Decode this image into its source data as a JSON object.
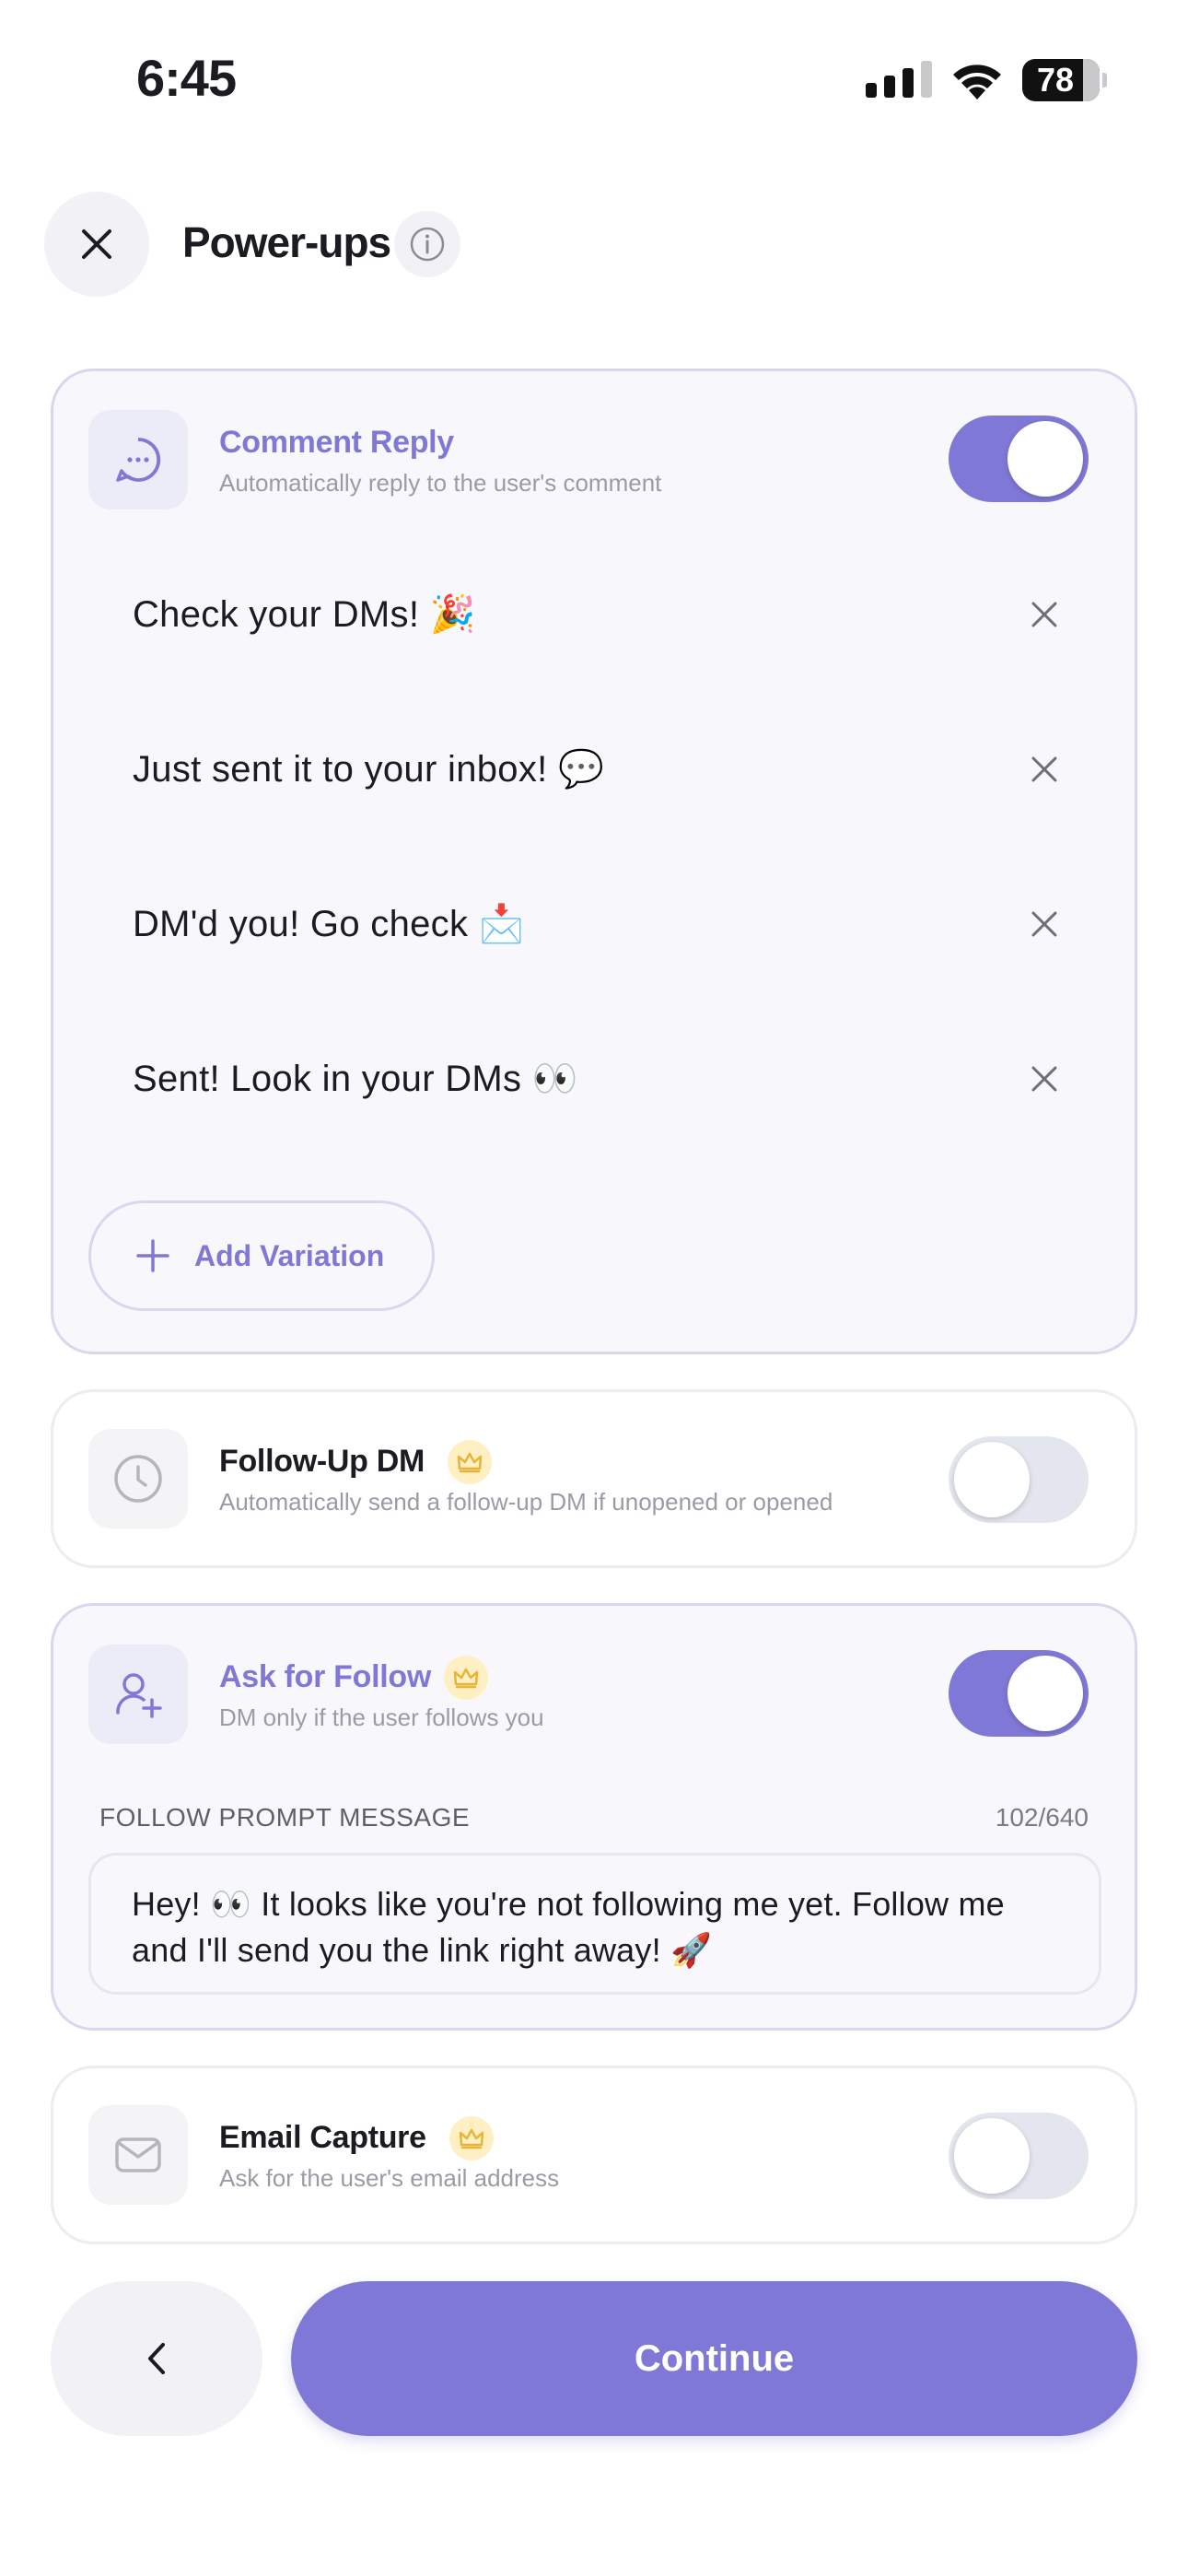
{
  "status_bar": {
    "time": "6:45",
    "battery": "78",
    "battery_level_percent": 78
  },
  "header": {
    "close_icon": "close-icon",
    "title": "Power-ups",
    "info_icon": "info-icon"
  },
  "comment_reply": {
    "title": "Comment Reply",
    "subtitle": "Automatically reply to the user's comment",
    "icon": "chat-bubble-icon",
    "enabled": true,
    "variations": [
      "Check your DMs! 🎉",
      "Just sent it to your inbox! 💬",
      "DM'd you! Go check 📩",
      "Sent! Look in your DMs 👀"
    ],
    "add_label": "Add Variation"
  },
  "follow_up_dm": {
    "title": "Follow-Up DM",
    "subtitle": "Automatically send a follow-up DM if unopened or opened",
    "icon": "clock-icon",
    "premium_icon": "crown-icon",
    "enabled": false
  },
  "ask_for_follow": {
    "title": "Ask for Follow",
    "subtitle": "DM only if the user follows you",
    "icon": "user-plus-icon",
    "premium_icon": "crown-icon",
    "enabled": true,
    "field_label": "FOLLOW PROMPT MESSAGE",
    "char_count": "102/640",
    "message": "Hey! 👀 It looks like you're not following me yet. Follow me and I'll send you the link right away! 🚀"
  },
  "email_capture": {
    "title": "Email Capture",
    "subtitle": "Ask for the user's email address",
    "icon": "envelope-icon",
    "premium_icon": "crown-icon",
    "enabled": false
  },
  "footer": {
    "back_icon": "chevron-left-icon",
    "continue_label": "Continue"
  },
  "colors": {
    "accent": "#8078d6",
    "accent_light": "#ecebf8",
    "crown_bg": "#fff0c4",
    "crown": "#e7b43a",
    "toggle_off": "#e3e6ef"
  }
}
